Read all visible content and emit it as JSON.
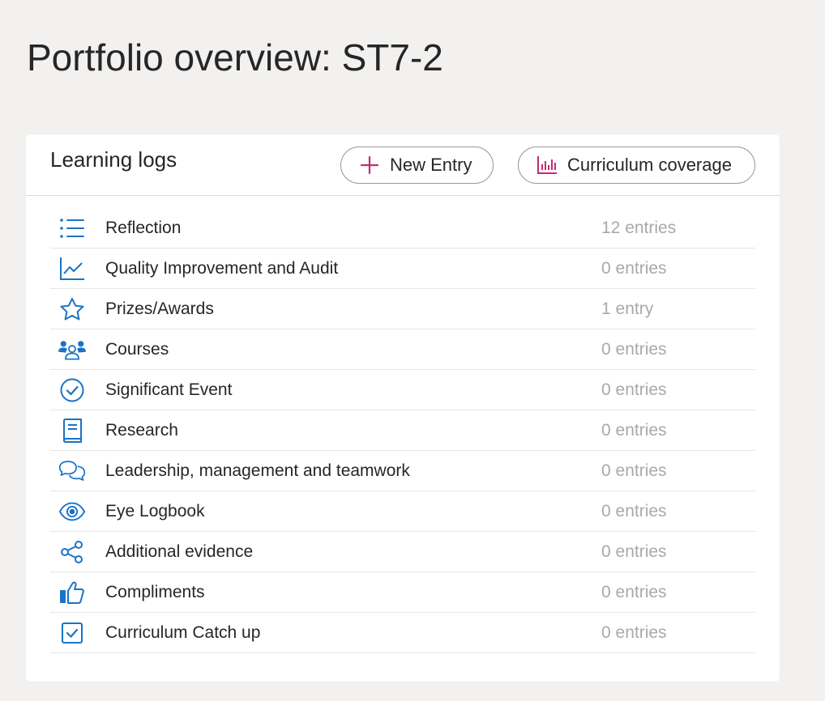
{
  "page": {
    "title": "Portfolio overview: ST7-2"
  },
  "card": {
    "title": "Learning logs",
    "new_entry_label": "New Entry",
    "new_entry_icon": "plus-icon",
    "coverage_label": "Curriculum coverage",
    "coverage_icon": "bar-chart-icon"
  },
  "colors": {
    "icon_blue": "#1a73c7",
    "accent_pink": "#c8287a",
    "muted_text": "#a9a9a9"
  },
  "logs": [
    {
      "label": "Reflection",
      "count": "12 entries",
      "icon": "list-icon"
    },
    {
      "label": "Quality Improvement and Audit",
      "count": "0 entries",
      "icon": "line-chart-icon"
    },
    {
      "label": "Prizes/Awards",
      "count": "1 entry",
      "icon": "star-icon"
    },
    {
      "label": "Courses",
      "count": "0 entries",
      "icon": "people-icon"
    },
    {
      "label": "Significant Event",
      "count": "0 entries",
      "icon": "check-circle-icon"
    },
    {
      "label": "Research",
      "count": "0 entries",
      "icon": "book-icon"
    },
    {
      "label": "Leadership, management and teamwork",
      "count": "0 entries",
      "icon": "chat-bubbles-icon"
    },
    {
      "label": "Eye Logbook",
      "count": "0 entries",
      "icon": "eye-icon"
    },
    {
      "label": "Additional evidence",
      "count": "0 entries",
      "icon": "share-icon"
    },
    {
      "label": "Compliments",
      "count": "0 entries",
      "icon": "thumbs-up-icon"
    },
    {
      "label": "Curriculum Catch up",
      "count": "0 entries",
      "icon": "check-square-icon"
    }
  ]
}
